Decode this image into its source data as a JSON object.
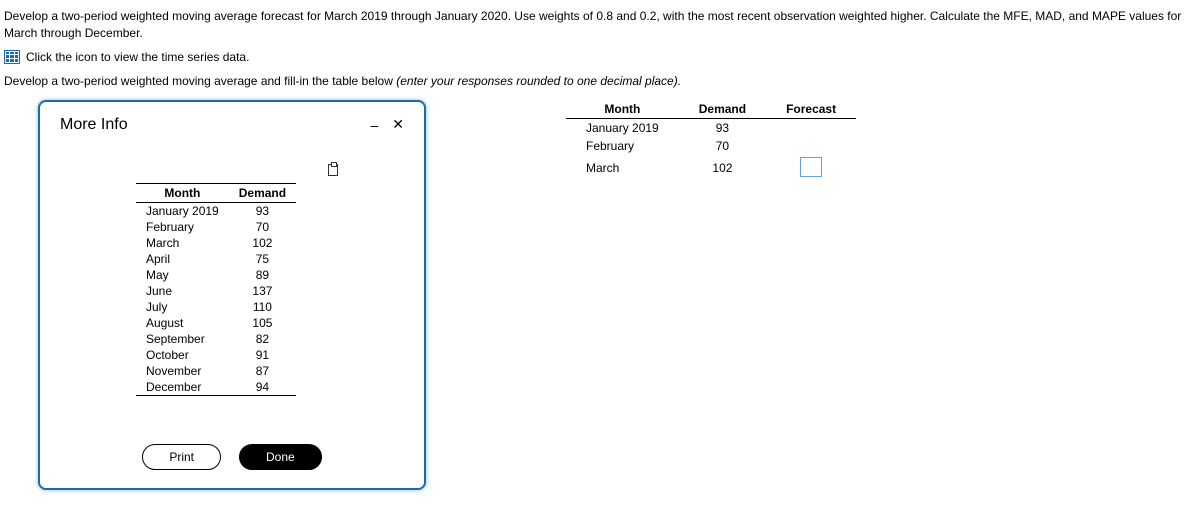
{
  "question": {
    "line1": "Develop a two-period weighted moving average forecast for March 2019 through January 2020. Use weights of 0.8 and 0.2, with the most recent observation weighted higher. Calculate the MFE, MAD, and MAPE values for March through December.",
    "linkText": "Click the icon to view the time series data.",
    "line2a": "Develop a two-period weighted moving average and fill-in the table below ",
    "line2b": "(enter your responses rounded to one decimal place)."
  },
  "modal": {
    "title": "More Info",
    "headers": {
      "month": "Month",
      "demand": "Demand"
    },
    "rows": [
      {
        "month": "January 2019",
        "demand": "93"
      },
      {
        "month": "February",
        "demand": "70"
      },
      {
        "month": "March",
        "demand": "102"
      },
      {
        "month": "April",
        "demand": "75"
      },
      {
        "month": "May",
        "demand": "89"
      },
      {
        "month": "June",
        "demand": "137"
      },
      {
        "month": "July",
        "demand": "110"
      },
      {
        "month": "August",
        "demand": "105"
      },
      {
        "month": "September",
        "demand": "82"
      },
      {
        "month": "October",
        "demand": "91"
      },
      {
        "month": "November",
        "demand": "87"
      },
      {
        "month": "December",
        "demand": "94"
      }
    ],
    "buttons": {
      "print": "Print",
      "done": "Done"
    }
  },
  "answer": {
    "headers": {
      "month": "Month",
      "demand": "Demand",
      "forecast": "Forecast"
    },
    "rows": [
      {
        "month": "January 2019",
        "demand": "93",
        "forecast": ""
      },
      {
        "month": "February",
        "demand": "70",
        "forecast": ""
      },
      {
        "month": "March",
        "demand": "102",
        "forecast": "input"
      }
    ]
  }
}
